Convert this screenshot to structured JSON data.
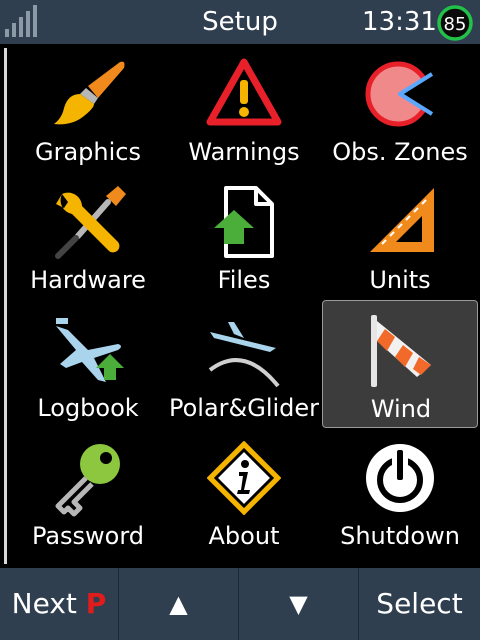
{
  "status_bar": {
    "title": "Setup",
    "time": "13:31",
    "battery_level": "85"
  },
  "menu": {
    "items": [
      {
        "label": "Graphics",
        "icon": "paintbrush-icon"
      },
      {
        "label": "Warnings",
        "icon": "warning-triangle-icon"
      },
      {
        "label": "Obs. Zones",
        "icon": "observation-zone-icon"
      },
      {
        "label": "Hardware",
        "icon": "wrench-screwdriver-icon"
      },
      {
        "label": "Files",
        "icon": "file-upload-icon"
      },
      {
        "label": "Units",
        "icon": "set-square-ruler-icon"
      },
      {
        "label": "Logbook",
        "icon": "plane-upload-icon"
      },
      {
        "label": "Polar&Glider",
        "icon": "glider-polar-icon"
      },
      {
        "label": "Wind",
        "icon": "windsock-icon",
        "selected": true
      },
      {
        "label": "Password",
        "icon": "key-icon"
      },
      {
        "label": "About",
        "icon": "info-diamond-icon"
      },
      {
        "label": "Shutdown",
        "icon": "power-icon"
      }
    ]
  },
  "bottom_bar": {
    "next_label": "Next",
    "next_hint": "P",
    "up_label": "▲",
    "down_label": "▼",
    "select_label": "Select"
  },
  "colors": {
    "bar_bg": "#2f3f4f",
    "hint_red": "#e21b1b",
    "selected_tile": "#3c3c3c"
  }
}
